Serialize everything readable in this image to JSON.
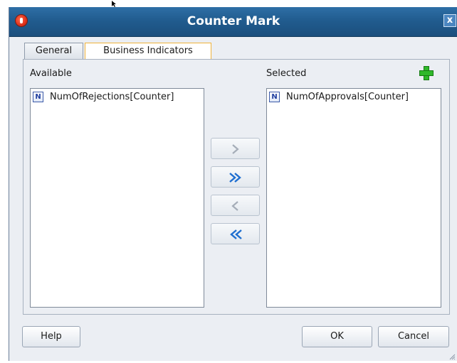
{
  "window": {
    "title": "Counter Mark",
    "close_label": "x"
  },
  "tabs": [
    {
      "label": "General",
      "selected": false
    },
    {
      "label": "Business Indicators",
      "selected": true
    }
  ],
  "available": {
    "label": "Available",
    "items": [
      {
        "badge": "N",
        "text": "NumOfRejections[Counter]"
      }
    ]
  },
  "selected": {
    "label": "Selected",
    "items": [
      {
        "badge": "N",
        "text": "NumOfApprovals[Counter]"
      }
    ]
  },
  "move_buttons": [
    {
      "icon": "chevron-right-icon",
      "enabled": false
    },
    {
      "icon": "double-chevron-right-icon",
      "enabled": true
    },
    {
      "icon": "chevron-left-icon",
      "enabled": false
    },
    {
      "icon": "double-chevron-left-icon",
      "enabled": true
    }
  ],
  "footer": {
    "help_label": "Help",
    "ok_label": "OK",
    "cancel_label": "Cancel"
  },
  "colors": {
    "titlebar": "#215c8f",
    "active_tab_border": "#f0b23a",
    "arrow_enabled": "#1f6fd0",
    "arrow_disabled": "#a5adb8",
    "add_icon": "#2fb82a"
  }
}
